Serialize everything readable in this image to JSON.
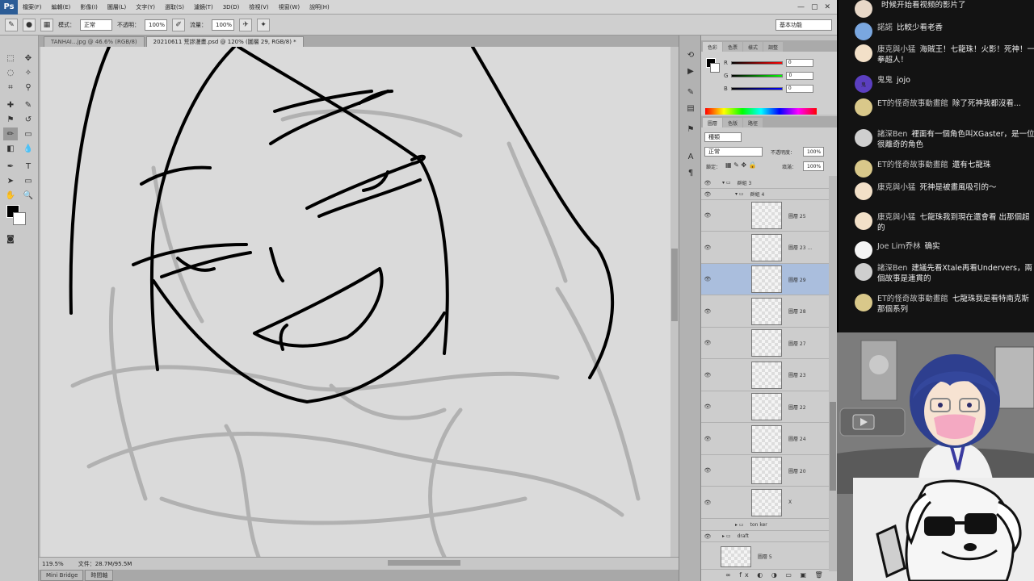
{
  "app": {
    "logo": "Ps",
    "window_controls": [
      "—",
      "▢",
      "✕"
    ]
  },
  "menu": [
    "檔案(F)",
    "編輯(E)",
    "影像(I)",
    "圖層(L)",
    "文字(Y)",
    "選取(S)",
    "濾鏡(T)",
    "3D(D)",
    "檢視(V)",
    "視窗(W)",
    "說明(H)"
  ],
  "options_bar": {
    "mode_label": "模式：",
    "mode_value": "正常",
    "opacity_label": "不透明：",
    "opacity_value": "100%",
    "flow_label": "流量：",
    "flow_value": "100%",
    "workspace": "基本功能"
  },
  "doc_tabs": [
    {
      "label": "TANHAI...jpg @ 46.6% (RGB/8)",
      "active": false
    },
    {
      "label": "20210611 荒謬漫畫.psd @ 120% (圖層 29, RGB/8) *",
      "active": true
    }
  ],
  "status": {
    "zoom": "119.5%",
    "doc": "文件：28.7M/95.5M"
  },
  "bottom_tabs": [
    "Mini Bridge",
    "時間軸"
  ],
  "color_panel": {
    "tabs": [
      "色彩",
      "色票",
      "樣式",
      "調整"
    ],
    "channels": [
      {
        "label": "R",
        "value": "0"
      },
      {
        "label": "G",
        "value": "0"
      },
      {
        "label": "B",
        "value": "0"
      }
    ]
  },
  "layers_panel": {
    "tabs": [
      "圖層",
      "色版",
      "路徑"
    ],
    "filter_label": "種類",
    "blend_mode": "正常",
    "opacity_label": "不透明度：",
    "opacity_value": "100%",
    "lock_label": "鎖定：",
    "fill_label": "填滿：",
    "fill_value": "100%",
    "groups": [
      {
        "name": "群組 3"
      },
      {
        "name": "群組 4"
      }
    ],
    "layers": [
      {
        "name": "圖層 25",
        "selected": false
      },
      {
        "name": "圖層 23 ...",
        "selected": false
      },
      {
        "name": "圖層 29",
        "selected": true
      },
      {
        "name": "圖層 28",
        "selected": false
      },
      {
        "name": "圖層 27",
        "selected": false
      },
      {
        "name": "圖層 23",
        "selected": false
      },
      {
        "name": "圖層 22",
        "selected": false
      },
      {
        "name": "圖層 24",
        "selected": false
      },
      {
        "name": "圖層 20",
        "selected": false
      },
      {
        "name": "X",
        "selected": false
      }
    ],
    "bottom_groups": [
      {
        "name": "ton ker"
      },
      {
        "name": "draft"
      }
    ],
    "last_layer": "圖層 5"
  },
  "chat": [
    {
      "author": "",
      "text": "时候开始看视频的影片了",
      "avatar_color": "#e8d8c8",
      "avatar_label": ""
    },
    {
      "author": "諾諾",
      "text": "比較少看老香",
      "avatar_color": "#7aa7e0",
      "avatar_label": ""
    },
    {
      "author": "康克與小猛",
      "text": "海賊王！七龍珠！火影！死神！一拳超人！",
      "avatar_color": "#f2e0c8",
      "avatar_label": ""
    },
    {
      "author": "鬼鬼",
      "text": "jojo",
      "avatar_color": "#5b3fc0",
      "avatar_label": "鬼"
    },
    {
      "author": "ET的怪奇故事動畫館",
      "text": "除了死神我都沒看...",
      "avatar_color": "#d9c88a",
      "avatar_label": ""
    },
    {
      "author": "諸深Ben",
      "text": "裡面有一個角色叫XGaster，是一位很離奇的角色",
      "avatar_color": "#cfcfcf",
      "avatar_label": ""
    },
    {
      "author": "ET的怪奇故事動畫館",
      "text": "還有七龍珠",
      "avatar_color": "#d9c88a",
      "avatar_label": ""
    },
    {
      "author": "康克與小猛",
      "text": "死神是被畫風吸引的～",
      "avatar_color": "#f2e0c8",
      "avatar_label": ""
    },
    {
      "author": "康克與小猛",
      "text": "七龍珠我到現在還會看 出那個超的",
      "avatar_color": "#f2e0c8",
      "avatar_label": ""
    },
    {
      "author": "Joe Lim乔林",
      "text": "确实",
      "avatar_color": "#f5f5f5",
      "avatar_label": ""
    },
    {
      "author": "諸深Ben",
      "text": "建議先看Xtale再看Undervers，兩個故事是連貫的",
      "avatar_color": "#cfcfcf",
      "avatar_label": ""
    },
    {
      "author": "ET的怪奇故事動畫館",
      "text": "七龍珠我是看特南克斯那個系列",
      "avatar_color": "#d9c88a",
      "avatar_label": ""
    }
  ]
}
